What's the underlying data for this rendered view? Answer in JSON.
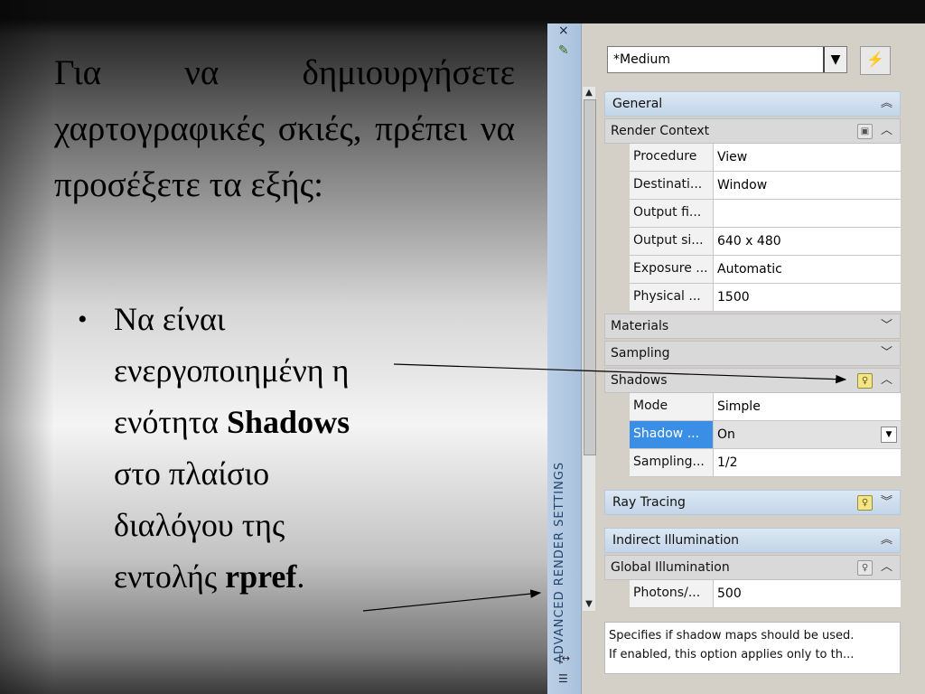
{
  "slide": {
    "intro": "Για να δημιουργήσετε χαρτογραφικές σκιές, πρέπει να προσέξετε τα εξής:",
    "bullet_char": "•",
    "bullet_pre": "Να είναι ενεργοποιημένη η ενότητα",
    "bullet_bold1": "Shadows",
    "bullet_mid": "στο πλαίσιο διαλόγου της εντολής",
    "bullet_bold2": "rpref",
    "bullet_end": "."
  },
  "panel": {
    "side_title": "ADVANCED RENDER SETTINGS",
    "close_glyph": "×",
    "style_value": "*Medium",
    "sections": {
      "general": "General",
      "render_context": "Render Context",
      "materials": "Materials",
      "sampling": "Sampling",
      "shadows": "Shadows",
      "ray_tracing": "Ray Tracing",
      "indirect_illumination": "Indirect Illumination",
      "global_illumination": "Global Illumination"
    },
    "render_context_rows": [
      {
        "name": "Procedure",
        "value": "View"
      },
      {
        "name": "Destinati...",
        "value": "Window"
      },
      {
        "name": "Output fi...",
        "value": ""
      },
      {
        "name": "Output si...",
        "value": "640 x 480"
      },
      {
        "name": "Exposure ...",
        "value": "Automatic"
      },
      {
        "name": "Physical ...",
        "value": "1500"
      }
    ],
    "shadow_rows": [
      {
        "name": "Mode",
        "value": "Simple"
      },
      {
        "name": "Shadow ...",
        "value": "On"
      },
      {
        "name": "Sampling...",
        "value": "1/2"
      }
    ],
    "gi_rows": [
      {
        "name": "Photons/...",
        "value": "500"
      }
    ],
    "help_line1": "Specifies if shadow maps should be used.",
    "help_line2": "If enabled, this option applies only to th..."
  }
}
